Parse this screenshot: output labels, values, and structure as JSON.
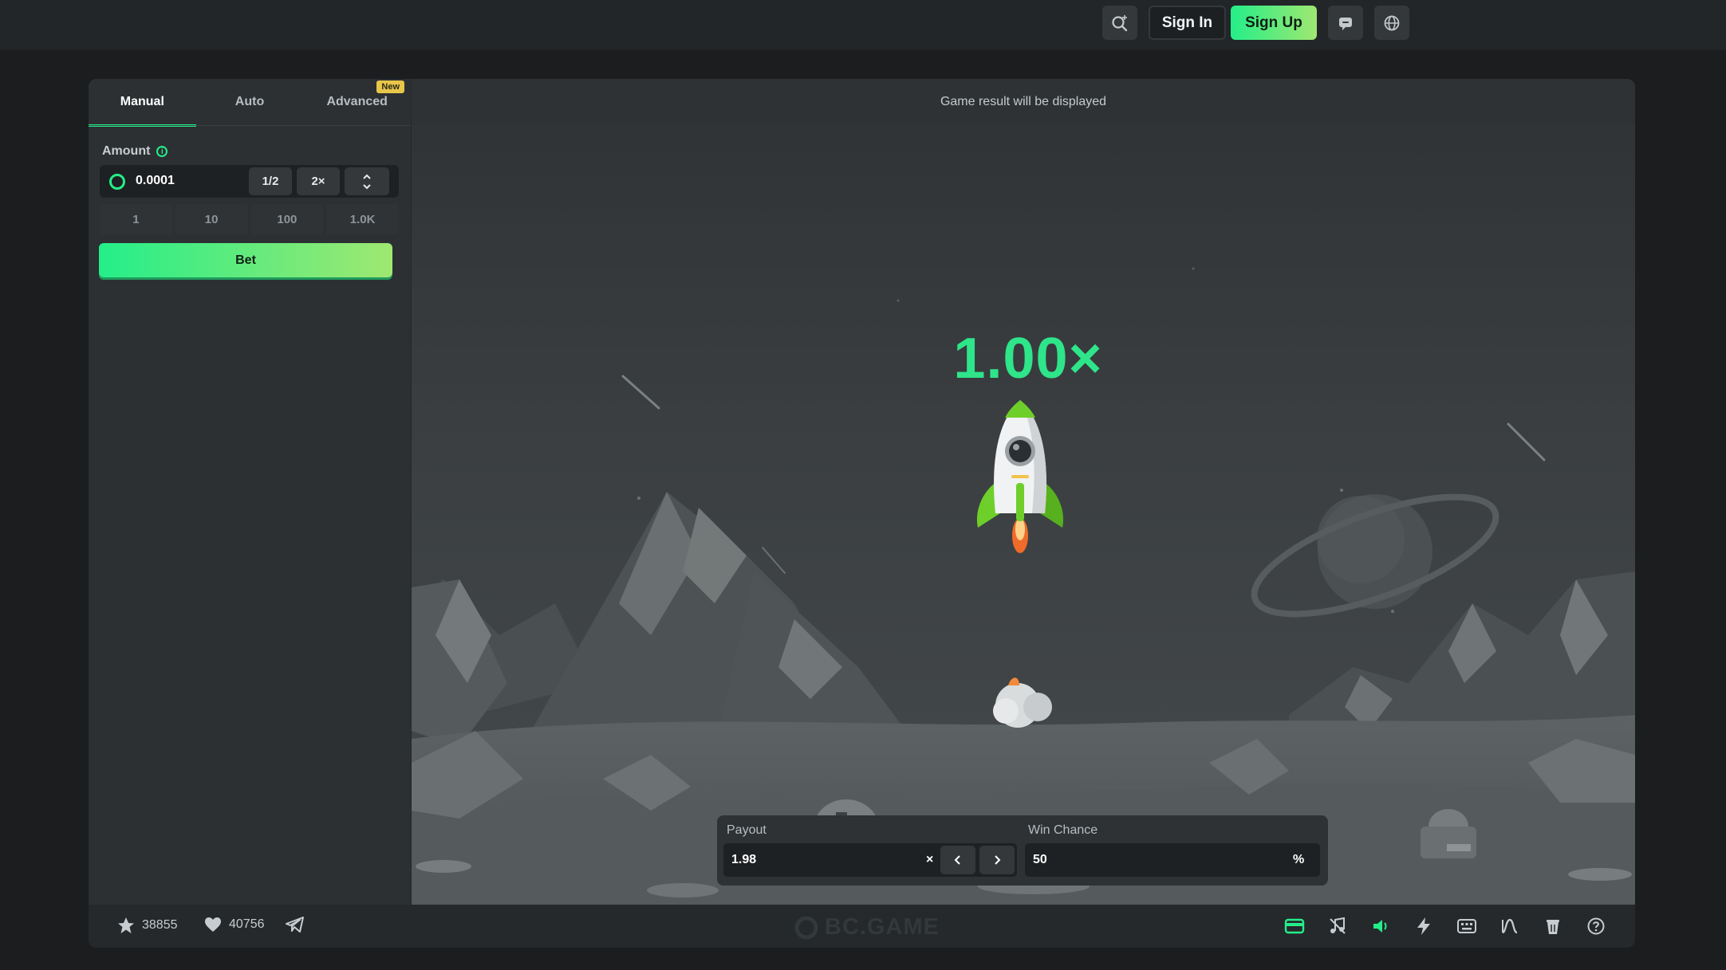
{
  "header": {
    "search_icon": "search-icon",
    "sign_in": "Sign In",
    "sign_up": "Sign Up",
    "chat_icon": "chat-icon",
    "language_icon": "globe-icon"
  },
  "sidebar": {
    "tabs": [
      {
        "label": "Manual",
        "active": true
      },
      {
        "label": "Auto",
        "active": false
      },
      {
        "label": "Advanced",
        "active": false,
        "badge": "New"
      }
    ],
    "amount_label": "Amount",
    "amount_value": "0.0001",
    "half_label": "1/2",
    "double_label": "2×",
    "quick_amounts": [
      "1",
      "10",
      "100",
      "1.0K"
    ],
    "bet_label": "Bet"
  },
  "game": {
    "result_text": "Game result will be displayed",
    "multiplier": "1.00×",
    "payout": {
      "label": "Payout",
      "value": "1.98",
      "suffix": "×"
    },
    "win_chance": {
      "label": "Win Chance",
      "value": "50",
      "suffix": "%"
    }
  },
  "footer": {
    "favorites_count": "38855",
    "likes_count": "40756",
    "brand": "BC.GAME",
    "icons": [
      "card-icon",
      "music-icon",
      "sound-icon",
      "lightning-icon",
      "keyboard-icon",
      "chart-icon",
      "fairness-icon",
      "help-icon"
    ]
  },
  "colors": {
    "accent": "#24ee89",
    "accent_end": "#9fe871",
    "multiplier": "#2ee58a",
    "badge": "#e8c64a"
  }
}
